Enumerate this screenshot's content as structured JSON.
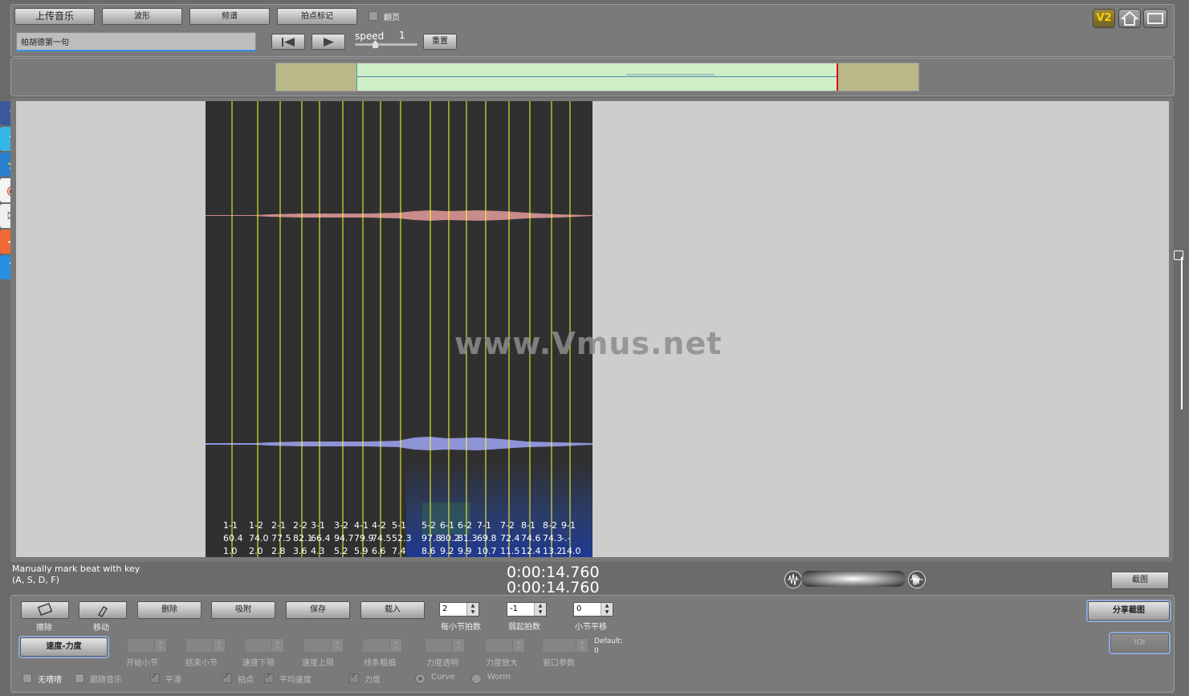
{
  "toolbar": {
    "upload": "上传音乐",
    "waveform": "波形",
    "spectrum": "频谱",
    "beat_mark": "拍点标记",
    "page_turn": "翻页",
    "song_title": "帕胡德第一句",
    "speed_label": "speed",
    "speed_value": "1",
    "reset": "重置",
    "version_badge": "V2"
  },
  "watermark": "www.Vmus.net",
  "beats": {
    "labels": [
      "1-1",
      "1-2",
      "2-1",
      "2-2",
      "3-1",
      "3-2",
      "4-1",
      "4-2",
      "5-1",
      "5-2",
      "6-1",
      "6-2",
      "7-1",
      "7-2",
      "8-1",
      "8-2",
      "9-1"
    ],
    "tempo": [
      "60.4",
      "74.0",
      "77.5",
      "82.1",
      "66.4",
      "94.7",
      "79.9",
      "74.5",
      "52.3",
      "97.8",
      "80.2",
      "81.3",
      "69.8",
      "72.4",
      "74.6",
      "74.3",
      "-.-"
    ],
    "times": [
      "1.0",
      "2.0",
      "2.8",
      "3.6",
      "4.3",
      "5.2",
      "5.9",
      "6.6",
      "7.4",
      "8.6",
      "9.2",
      "9.9",
      "10.7",
      "11.5",
      "12.4",
      "13.2",
      "14.0"
    ]
  },
  "status": {
    "hint_line1": "Manually mark beat with key",
    "hint_line2": "(A, S, D, F)",
    "time_current": "0:00:14.760",
    "time_total": "0:00:14.760",
    "screenshot": "截图"
  },
  "tools": {
    "erase": "擦除",
    "move": "移动",
    "delete": "删除",
    "snap": "吸附",
    "save": "保存",
    "load": "载入",
    "beats_per_bar_label": "每小节拍数",
    "beats_per_bar": "2",
    "pickup_label": "弱起拍数",
    "pickup": "-1",
    "bar_shift_label": "小节平移",
    "bar_shift": "0",
    "share_screenshot": "分享截图",
    "tempo_dynamics": "速度-力度",
    "ioi": "IOI",
    "start_bar": "开始小节",
    "end_bar": "结束小节",
    "tempo_min": "速度下限",
    "tempo_max": "速度上限",
    "line_width": "线条粗细",
    "dyn_opacity": "力度透明",
    "dyn_scale": "力度放大",
    "window_param": "窗口参数",
    "default_label": "Default:",
    "default_value": "0",
    "no_noise": "无嘈嘈",
    "follow_music": "跟随音乐",
    "smooth": "平滑",
    "beat_point": "拍点",
    "avg_tempo": "平均速度",
    "dynamics": "力度",
    "curve": "Curve",
    "worm": "Worm"
  }
}
